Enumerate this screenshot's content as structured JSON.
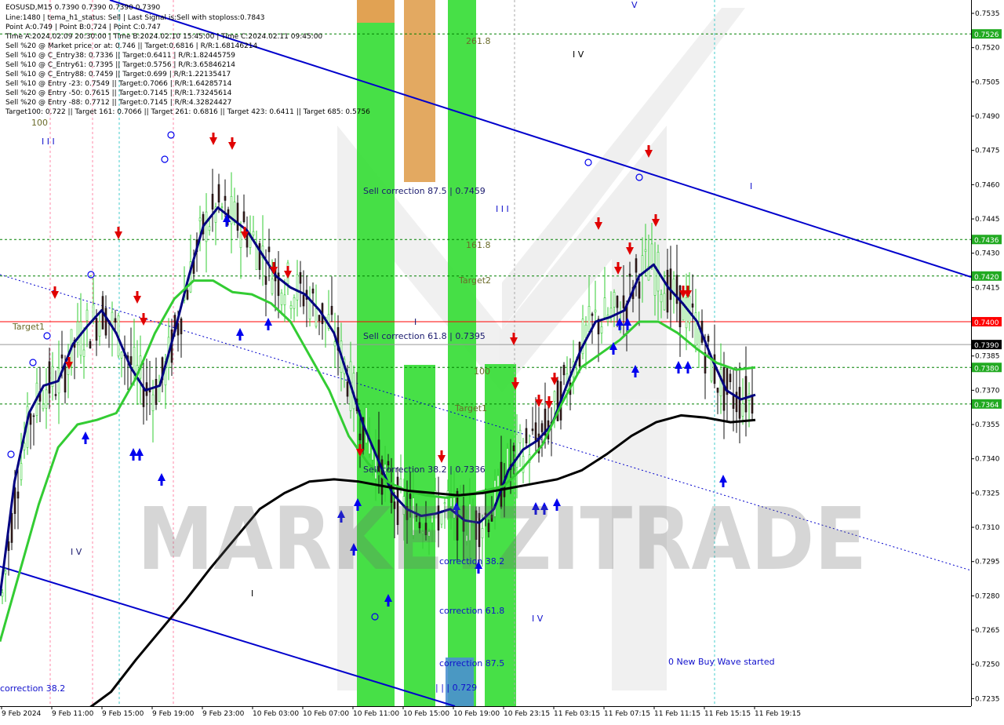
{
  "chart_title": "EOSUSD,M15  0.7390 0.7390 0.7390 0.7390",
  "info_lines": [
    "Line:1480 | tema_h1_status: Sell | Last Signal is:Sell with stoploss:0.7843",
    "Point A:0.749 | Point B:0.724 | Point C:0.747",
    "Time A:2024.02.09 20:30:00 | Time B:2024.02.10 15:45:00 | Time C:2024.02.11 09:45:00",
    "Sell %20 @ Market price or at: 0.746 || Target:0.6816 | R/R:1.68146214",
    "Sell %10 @ C_Entry38: 0.7336 || Target:0.6411 | R/R:1.82445759",
    "Sell %10 @ C_Entry61: 0.7395 || Target:0.5756 | R/R:3.65846214",
    "Sell %10 @ C_Entry88: 0.7459 || Target:0.699 | R/R:1.22135417",
    "Sell %10 @ Entry -23: 0.7549 || Target:0.7066 | R/R:1.64285714",
    "Sell %20 @ Entry -50: 0.7615 || Target:0.7145 | R/R:1.73245614",
    "Sell %20 @ Entry -88: 0.7712 || Target:0.7145 | R/R:4.32824427",
    "Target100: 0.722 || Target 161: 0.7066 || Target 261: 0.6816 || Target 423: 0.6411 || Target 685: 0.5756"
  ],
  "watermark": "MARKETZITRADE",
  "annotations": {
    "sell_correction_875": "Sell correction 87.5 | 0.7459",
    "sell_correction_618": "Sell correction 61.8 | 0.7395",
    "sell_correction_382": "Sell correction 38.2 | 0.7336",
    "correction_382_mid": "correction 38.2",
    "correction_618": "correction 61.8",
    "correction_875": "correction 87.5",
    "correction_382_left": "correction 38.2",
    "wave_point": "| | | 0.729",
    "new_buy_wave": "0 New Buy Wave started",
    "fib_2618": "261.8",
    "fib_1618": "161.8",
    "fib_100_top": "100",
    "fib_100_mid": "100",
    "target1_left": "Target1",
    "target1_mid": "Target1",
    "target2": "Target2",
    "wave_iii_left": "I I I",
    "wave_iv_left": "I V",
    "wave_i_left": "I",
    "wave_iii_mid": "I I I",
    "wave_i_mid": "I",
    "wave_iv_top": "I V",
    "wave_iv_bottom": "I V",
    "wave_i_right": "I",
    "wave_v_top": "V"
  },
  "colors": {
    "trend_channel": "#0000cc",
    "ema_fast": "#000080",
    "ema_mid": "#33cc33",
    "ema_slow": "#000000",
    "resistance_line": "#ff0000",
    "support_levels": "#008000",
    "green_zone": "#33dd33",
    "orange_zone": "#e0a050",
    "blue_zone": "#4a90d0",
    "sell_arrow": "#e00000",
    "buy_arrow": "#0000ee",
    "price_tag_current": "#000000"
  },
  "chart_data": {
    "type": "line",
    "title": "EOSUSD,M15",
    "ylim": [
      0.7232,
      0.7535
    ],
    "y_ticks": [
      "0.7535",
      "0.7520",
      "0.7505",
      "0.7490",
      "0.7475",
      "0.7460",
      "0.7445",
      "0.7430",
      "0.7415",
      "0.7400",
      "0.7385",
      "0.7370",
      "0.7355",
      "0.7340",
      "0.7325",
      "0.7310",
      "0.7295",
      "0.7280",
      "0.7265",
      "0.7250",
      "0.7235"
    ],
    "x_ticks": [
      "9 Feb 2024",
      "9 Feb 11:00",
      "9 Feb 15:00",
      "9 Feb 19:00",
      "9 Feb 23:00",
      "10 Feb 03:00",
      "10 Feb 07:00",
      "10 Feb 11:00",
      "10 Feb 15:00",
      "10 Feb 19:00",
      "10 Feb 23:15",
      "11 Feb 03:15",
      "11 Feb 07:15",
      "11 Feb 11:15",
      "11 Feb 15:15",
      "11 Feb 19:15"
    ],
    "levels": [
      {
        "name": "0.7526",
        "value": 0.7526,
        "style": "green-dashed"
      },
      {
        "name": "0.7436",
        "value": 0.7436,
        "style": "green-dashed"
      },
      {
        "name": "0.7420",
        "value": 0.742,
        "style": "green-dashed"
      },
      {
        "name": "0.7400",
        "value": 0.74,
        "style": "red-solid"
      },
      {
        "name": "0.7390",
        "value": 0.739,
        "style": "current"
      },
      {
        "name": "0.7380",
        "value": 0.738,
        "style": "green-dashed"
      },
      {
        "name": "0.7364",
        "value": 0.7364,
        "style": "green-dashed"
      }
    ],
    "current_price": "0.7390",
    "series": [
      {
        "name": "fast",
        "values": [
          0.728,
          0.733,
          0.736,
          0.7372,
          0.7374,
          0.739,
          0.7398,
          0.7405,
          0.7395,
          0.738,
          0.737,
          0.7372,
          0.7395,
          0.742,
          0.7442,
          0.745,
          0.7445,
          0.744,
          0.743,
          0.742,
          0.7415,
          0.7412,
          0.7405,
          0.7395,
          0.7375,
          0.7355,
          0.734,
          0.7325,
          0.7318,
          0.7315,
          0.7316,
          0.7318,
          0.7313,
          0.7312,
          0.7318,
          0.7335,
          0.7344,
          0.7348,
          0.7355,
          0.7372,
          0.7388,
          0.74,
          0.7402,
          0.7405,
          0.742,
          0.7425,
          0.7415,
          0.7408,
          0.74,
          0.7384,
          0.737,
          0.7366,
          0.7368
        ]
      },
      {
        "name": "mid",
        "values": [
          0.726,
          0.729,
          0.732,
          0.7345,
          0.7355,
          0.7357,
          0.736,
          0.7375,
          0.7395,
          0.741,
          0.7418,
          0.7418,
          0.7413,
          0.7412,
          0.7408,
          0.74,
          0.7385,
          0.737,
          0.735,
          0.7338,
          0.733,
          0.7326,
          0.7324,
          0.7323,
          0.7324,
          0.7326,
          0.7328,
          0.7336,
          0.7346,
          0.7364,
          0.738,
          0.7386,
          0.7392,
          0.74,
          0.74,
          0.7395,
          0.7388,
          0.7382,
          0.7379,
          0.738
        ]
      },
      {
        "name": "slow",
        "values": [
          0.723,
          0.7238,
          0.7252,
          0.7265,
          0.7278,
          0.7292,
          0.7305,
          0.7318,
          0.7325,
          0.733,
          0.7331,
          0.733,
          0.7328,
          0.7326,
          0.7325,
          0.7324,
          0.7325,
          0.7327,
          0.7329,
          0.7331,
          0.7335,
          0.7342,
          0.735,
          0.7356,
          0.7359,
          0.7358,
          0.7356,
          0.7357
        ]
      }
    ]
  }
}
